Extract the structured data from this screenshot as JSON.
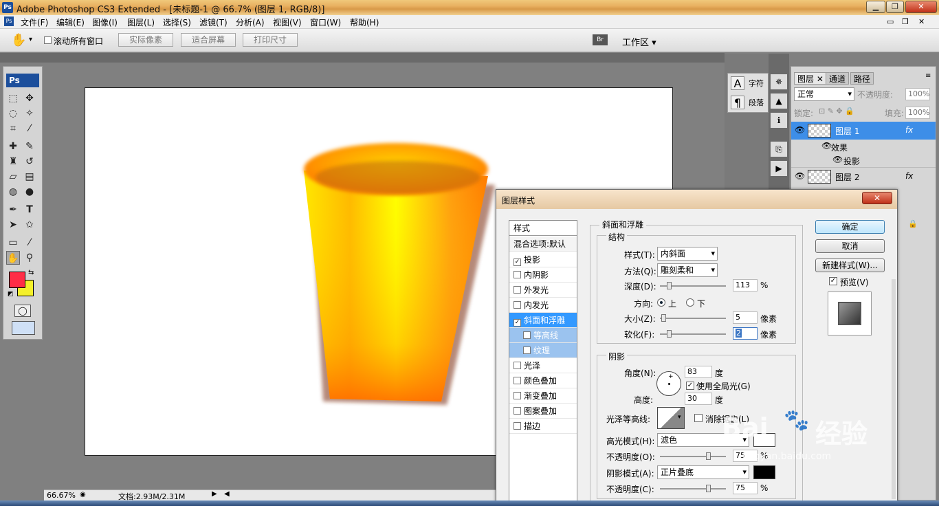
{
  "window": {
    "title": "Adobe Photoshop CS3 Extended - [未标题-1 @ 66.7% (图层 1, RGB/8)]",
    "app_icon": "Ps"
  },
  "menu": [
    "文件(F)",
    "编辑(E)",
    "图像(I)",
    "图层(L)",
    "选择(S)",
    "滤镜(T)",
    "分析(A)",
    "视图(V)",
    "窗口(W)",
    "帮助(H)"
  ],
  "options": {
    "scroll_all": "滚动所有窗口",
    "actual_pixels": "实际像素",
    "fit_screen": "适合屏幕",
    "print_size": "打印尺寸",
    "workspace": "工作区 ▾"
  },
  "toolbox": {
    "logo": "Ps",
    "foreground_color": "#ff2d46",
    "background_color": "#f4f02a"
  },
  "status": {
    "zoom": "66.67%",
    "doc": "文档:2.93M/2.31M"
  },
  "char_panel": {
    "char": "字符",
    "para": "段落"
  },
  "layers_panel": {
    "tabs": [
      "图层",
      "通道",
      "路径"
    ],
    "blend_mode": "正常",
    "opacity_label": "不透明度:",
    "opacity": "100%",
    "lock_label": "锁定:",
    "fill_label": "填充:",
    "fill": "100%",
    "layers": [
      {
        "name": "图层 1",
        "fx": "fx",
        "selected": true
      },
      {
        "name": "效果",
        "fx": "",
        "selected": false
      },
      {
        "name": "投影",
        "fx": "",
        "selected": false
      },
      {
        "name": "图层 2",
        "fx": "fx",
        "selected": false
      }
    ]
  },
  "dialog": {
    "title": "图层样式",
    "styles_header": "样式",
    "blend_default": "混合选项:默认",
    "styles": [
      {
        "label": "投影",
        "checked": true,
        "active": false,
        "sub": false
      },
      {
        "label": "内阴影",
        "checked": false,
        "active": false,
        "sub": false
      },
      {
        "label": "外发光",
        "checked": false,
        "active": false,
        "sub": false
      },
      {
        "label": "内发光",
        "checked": false,
        "active": false,
        "sub": false
      },
      {
        "label": "斜面和浮雕",
        "checked": true,
        "active": true,
        "sub": false
      },
      {
        "label": "等高线",
        "checked": false,
        "active": true,
        "sub": true
      },
      {
        "label": "纹理",
        "checked": false,
        "active": true,
        "sub": true
      },
      {
        "label": "光泽",
        "checked": false,
        "active": false,
        "sub": false
      },
      {
        "label": "颜色叠加",
        "checked": false,
        "active": false,
        "sub": false
      },
      {
        "label": "渐变叠加",
        "checked": false,
        "active": false,
        "sub": false
      },
      {
        "label": "图案叠加",
        "checked": false,
        "active": false,
        "sub": false
      },
      {
        "label": "描边",
        "checked": false,
        "active": false,
        "sub": false
      }
    ],
    "bevel": {
      "section": "斜面和浮雕",
      "structure": "结构",
      "style_label": "样式(T):",
      "style": "内斜面",
      "technique_label": "方法(Q):",
      "technique": "雕刻柔和",
      "depth_label": "深度(D):",
      "depth": "113",
      "depth_unit": "%",
      "depth_level": 0.11,
      "direction_label": "方向:",
      "dir_up": "上",
      "dir_down": "下",
      "size_label": "大小(Z):",
      "size": "5",
      "size_unit": "像素",
      "size_level": 0.02,
      "soften_label": "软化(F):",
      "soften": "2",
      "soften_unit": "像素",
      "soften_level": 0.11
    },
    "shading": {
      "section": "阴影",
      "angle_label": "角度(N):",
      "angle": "83",
      "angle_unit": "度",
      "global_light": "使用全局光(G)",
      "altitude_label": "高度:",
      "altitude": "30",
      "altitude_unit": "度",
      "gloss_label": "光泽等高线:",
      "anti_alias": "消除锯齿(L)",
      "highlight_label": "高光模式(H):",
      "highlight_mode": "滤色",
      "h_opacity_label": "不透明度(O):",
      "h_opacity": "75",
      "h_opacity_level": 0.75,
      "shadow_label": "阴影模式(A):",
      "shadow_mode": "正片叠底",
      "s_opacity_label": "不透明度(C):",
      "s_opacity": "75",
      "s_opacity_level": 0.75,
      "percent": "%"
    },
    "buttons": {
      "ok": "确定",
      "cancel": "取消",
      "new_style": "新建样式(W)...",
      "preview": "预览(V)"
    }
  },
  "watermark": {
    "brand": "Bai",
    "brand2": "经验",
    "url": "jingyan.baidu.com"
  }
}
